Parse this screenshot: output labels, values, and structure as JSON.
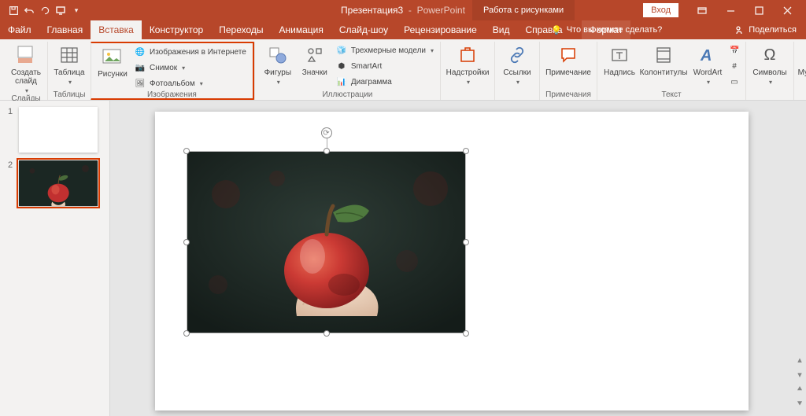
{
  "title": {
    "doc": "Презентация3",
    "app": "PowerPoint"
  },
  "toolTab": "Работа с рисунками",
  "signin": "Вход",
  "tabs": {
    "file": "Файл",
    "home": "Главная",
    "insert": "Вставка",
    "design": "Конструктор",
    "transitions": "Переходы",
    "animations": "Анимация",
    "slideshow": "Слайд-шоу",
    "review": "Рецензирование",
    "view": "Вид",
    "help": "Справка",
    "format": "Формат"
  },
  "tellme": "Что вы хотите сделать?",
  "share": "Поделиться",
  "ribbon": {
    "slides": {
      "new": "Создать слайд",
      "group": "Слайды"
    },
    "tables": {
      "btn": "Таблица",
      "group": "Таблицы"
    },
    "images": {
      "pictures": "Рисунки",
      "online": "Изображения в Интернете",
      "screenshot": "Снимок",
      "album": "Фотоальбом",
      "group": "Изображения"
    },
    "illus": {
      "shapes": "Фигуры",
      "icons": "Значки",
      "models": "Трехмерные модели",
      "smartart": "SmartArt",
      "chart": "Диаграмма",
      "group": "Иллюстрации"
    },
    "addins": {
      "btn": "Надстройки",
      "group": ""
    },
    "links": {
      "btn": "Ссылки",
      "group": ""
    },
    "comments": {
      "btn": "Примечание",
      "group": "Примечания"
    },
    "text": {
      "textbox": "Надпись",
      "headerfooter": "Колонтитулы",
      "wordart": "WordArt",
      "group": "Текст"
    },
    "symbols": {
      "btn": "Символы",
      "group": ""
    },
    "media": {
      "btn": "Мультимедиа",
      "group": ""
    }
  },
  "thumbs": {
    "n1": "1",
    "n2": "2"
  }
}
